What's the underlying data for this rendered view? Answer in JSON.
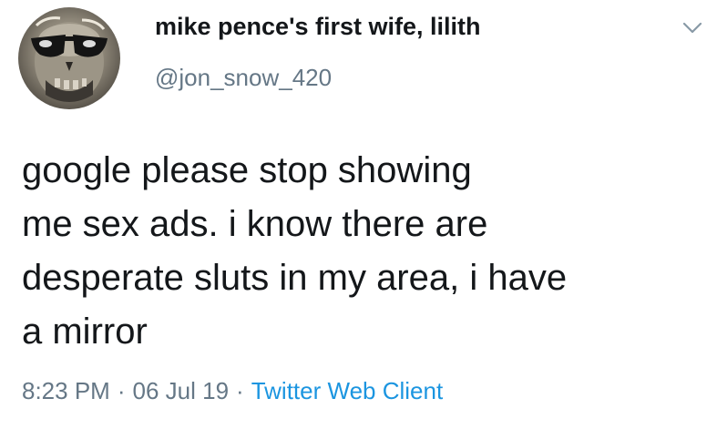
{
  "user": {
    "display_name": "mike pence's first wife, lilith",
    "handle": "@jon_snow_420"
  },
  "tweet": {
    "lines": [
      "google please stop showing",
      "me sex ads. i know there are",
      "desperate sluts in my area, i have",
      "a mirror"
    ]
  },
  "meta": {
    "time": "8:23 PM",
    "separator": "·",
    "date": "06 Jul 19",
    "client": "Twitter Web Client"
  },
  "icons": {
    "avatar": "avatar-skull-sunglasses",
    "caret": "chevron-down-icon"
  },
  "colors": {
    "text": "#14171a",
    "secondary": "#657786",
    "link": "#1b95e0",
    "caret": "#8899a6"
  }
}
